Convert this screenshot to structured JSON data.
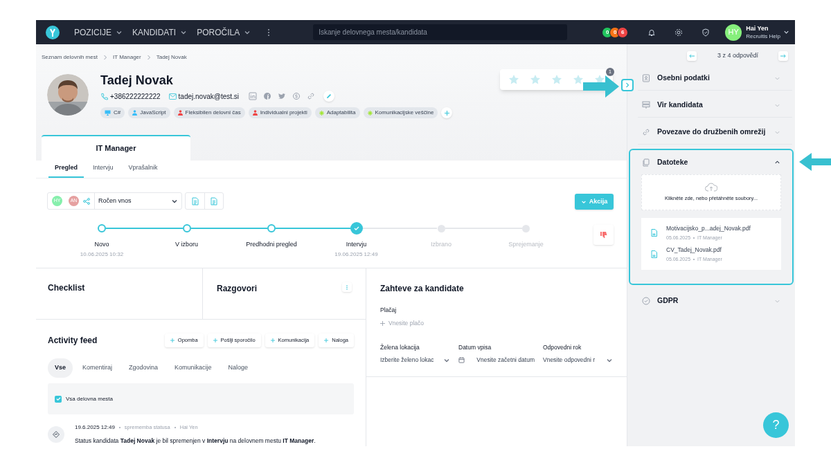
{
  "nav": {
    "menus": [
      {
        "label": "POZICIJE"
      },
      {
        "label": "KANDIDATI"
      },
      {
        "label": "POROČILA"
      }
    ],
    "search_placeholder": "Iskanje delovnega mesta/kandidata",
    "counters": [
      {
        "value": "0",
        "color": "#22c55e"
      },
      {
        "value": "0",
        "color": "#f97316"
      },
      {
        "value": "6",
        "color": "#ef4444"
      }
    ],
    "user": {
      "initials": "HY",
      "name": "Hai Yen",
      "company": "Recruitis Help"
    }
  },
  "breadcrumb": [
    "Seznam delovnih mest",
    "IT Manager",
    "Tadej Novak"
  ],
  "candidate": {
    "name": "Tadej Novak",
    "phone": "+386222222222",
    "email": "tadej.novak@test.si",
    "tags": [
      {
        "label": "C#",
        "kind": "tech",
        "color": "#38bdf8"
      },
      {
        "label": "JavaScript",
        "kind": "person",
        "color": "#38bdf8"
      },
      {
        "label": "Fleksibilen delovni čas",
        "kind": "person",
        "color": "#ef4444"
      },
      {
        "label": "Individualni projekti",
        "kind": "person",
        "color": "#ef4444"
      },
      {
        "label": "Adaptabilita",
        "kind": "skill",
        "color": "#a3e635"
      },
      {
        "label": "Komunikacijske veščine",
        "kind": "skill",
        "color": "#a3e635"
      }
    ]
  },
  "rating": {
    "stars": 0,
    "count": "1"
  },
  "job_tab": "IT Manager",
  "subtabs": [
    {
      "label": "Pregled",
      "selected": true
    },
    {
      "label": "Intervju",
      "selected": false
    },
    {
      "label": "Vprašalnik",
      "selected": false
    }
  ],
  "toolbar": {
    "avatars": [
      {
        "initials": "HY",
        "color": "#86efac"
      },
      {
        "initials": "AN",
        "color": "#e5a0a0"
      }
    ],
    "source": "Ročen vnos",
    "action": "Akcija"
  },
  "pipeline": [
    {
      "label": "Novo",
      "date": "10.06.2025 10:32",
      "kind": "done"
    },
    {
      "label": "V izboru",
      "kind": "done"
    },
    {
      "label": "Predhodni pregled",
      "kind": "done"
    },
    {
      "label": "Intervju",
      "date": "19.06.2025 12:49",
      "kind": "current"
    },
    {
      "label": "Izbrano",
      "kind": "pending"
    },
    {
      "label": "Sprejemanje",
      "kind": "pending"
    }
  ],
  "checklist": {
    "title": "Checklist"
  },
  "conversations": {
    "title": "Razgovori"
  },
  "activity": {
    "title": "Activity feed",
    "buttons": [
      "Opomba",
      "Pošlji sporočilo",
      "Komunikacija",
      "Naloga"
    ],
    "filters": [
      {
        "label": "Vse",
        "selected": true
      },
      {
        "label": "Komentiraj",
        "selected": false
      },
      {
        "label": "Zgodovina",
        "selected": false
      },
      {
        "label": "Komunikacije",
        "selected": false
      },
      {
        "label": "Naloge",
        "selected": false
      }
    ],
    "filter_checkbox": {
      "label": "Vsa delovna mesta",
      "checked": true
    },
    "entries": [
      {
        "time": "19.6.2025 12:49",
        "type": "sprememba statusa",
        "author": "Hai Yen",
        "text": "Status kandidata **Tadej Novak** je bil spremenjen v **Intervju** na delovnem mestu **IT Manager**."
      }
    ]
  },
  "requirements": {
    "title": "Zahteve za kandidate",
    "salary_label": "Plačaj",
    "salary_placeholder": "Vnesite plačo",
    "fields": [
      {
        "label": "Želena lokacija",
        "placeholder": "Izberite želeno lokac",
        "kind": "select"
      },
      {
        "label": "Datum vpisa",
        "placeholder": "Vnesite začetni datum",
        "kind": "date"
      },
      {
        "label": "Odpovedni rok",
        "placeholder": "Vnesite odpovedni r",
        "kind": "select"
      }
    ]
  },
  "side_panel": {
    "pager": "3 z 4 odpovědí",
    "sections": [
      {
        "title": "Osebni podatki",
        "expanded": false,
        "highlighted": false
      },
      {
        "title": "Vir kandidata",
        "expanded": false,
        "highlighted": false
      },
      {
        "title": "Povezave do družbenih omrežij",
        "expanded": false,
        "highlighted": false
      },
      {
        "title": "Datoteke",
        "expanded": true,
        "highlighted": true
      },
      {
        "title": "GDPR",
        "expanded": false,
        "highlighted": false
      }
    ],
    "upload_text": "Klikněte zde, nebo přetáhněte soubory...",
    "files": [
      {
        "name": "Motivacijsko_p...adej_Novak.pdf",
        "date": "05.06.2025",
        "job": "IT Manager"
      },
      {
        "name": "CV_Tadej_Novak.pdf",
        "date": "05.06.2025",
        "job": "IT Manager"
      }
    ]
  },
  "help": "?"
}
